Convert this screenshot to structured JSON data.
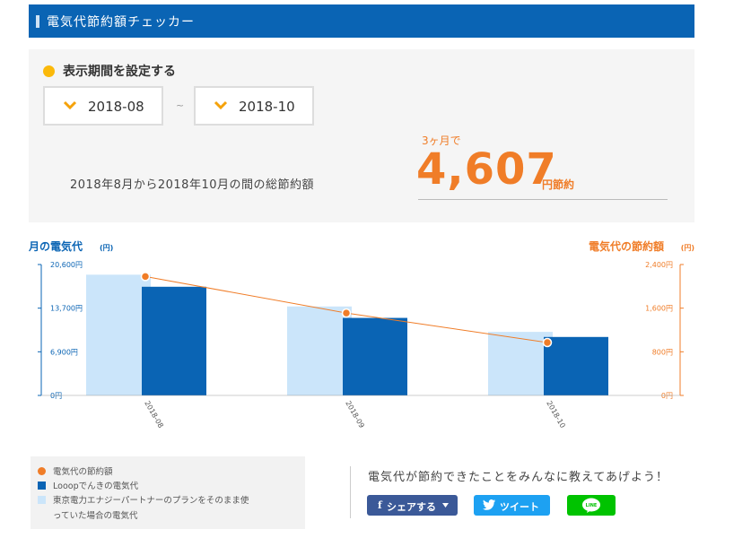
{
  "header": {
    "title": "電気代節約額チェッカー"
  },
  "period": {
    "label": "表示期間を設定する",
    "from": "2018-08",
    "separator": "~",
    "to": "2018-10"
  },
  "summary": {
    "months_label": "3ヶ月で",
    "description": "2018年8月から2018年10月の間の総節約額",
    "amount": "4,607",
    "unit": "円節約"
  },
  "chart_data": {
    "type": "bar",
    "title_left": "月の電気代",
    "title_left_unit": "(円)",
    "title_right": "電気代の節約額",
    "title_right_unit": "(円)",
    "categories": [
      "2018-08",
      "2018-09",
      "2018-10"
    ],
    "y_left_ticks": [
      "20,600円",
      "13,700円",
      "6,900円",
      "0円"
    ],
    "y_left_max": 20600,
    "y_right_ticks": [
      "2,400円",
      "1,600円",
      "800円",
      "0円"
    ],
    "y_right_max": 2400,
    "series": [
      {
        "name": "東京電力エナジーパートナーのプランをそのまま使っていた場合の電気代",
        "kind": "bar",
        "axis": "left",
        "color": "#cbe5fa",
        "values": [
          19000,
          14000,
          10000
        ]
      },
      {
        "name": "Looopでんきの電気代",
        "kind": "bar",
        "axis": "left",
        "color": "#0a64b4",
        "values": [
          17100,
          12200,
          9200
        ]
      },
      {
        "name": "電気代の節約額",
        "kind": "line",
        "axis": "right",
        "color": "#f07d28",
        "values": [
          2180,
          1510,
          970
        ]
      }
    ]
  },
  "legend": {
    "savings": "電気代の節約額",
    "looop": "Looopでんきの電気代",
    "tepco_line1": "東京電力エナジーパートナーのプランをそのまま使",
    "tepco_line2": "っていた場合の電気代"
  },
  "share": {
    "message": "電気代が節約できたことをみんなに教えてあげよう！",
    "facebook": "シェアする",
    "twitter": "ツイート",
    "line": "LINE"
  },
  "colors": {
    "brand_blue": "#0a64b4",
    "accent_orange": "#f07d28",
    "light_blue": "#cbe5fa",
    "yellow": "#fbb90a"
  }
}
